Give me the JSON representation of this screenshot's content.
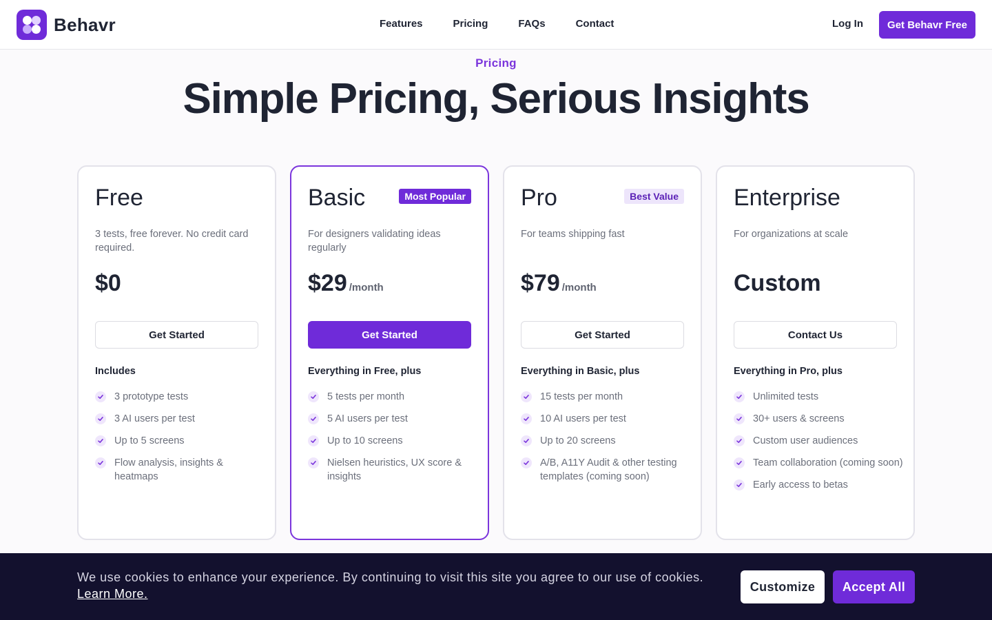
{
  "brand": {
    "name": "Behavr",
    "accent_color": "#6f2bd9",
    "logo_icon": "four-dots-logo-icon"
  },
  "nav": {
    "items": [
      "Features",
      "Pricing",
      "FAQs",
      "Contact"
    ],
    "login_label": "Log In",
    "cta_label": "Get Behavr Free"
  },
  "hero": {
    "eyebrow": "Pricing",
    "title": "Simple Pricing, Serious Insights"
  },
  "plans": [
    {
      "name": "Free",
      "badge": "",
      "description": "3 tests, free forever. No credit card required.",
      "price": "$0",
      "period": "",
      "button_label": "Get Started",
      "includes_label": "Includes",
      "features": [
        "3 prototype tests",
        "3 AI users per test",
        "Up to 5 screens",
        "Flow analysis, insights & heatmaps"
      ]
    },
    {
      "name": "Basic",
      "badge": "Most Popular",
      "description": "For designers validating ideas regularly",
      "price": "$29",
      "period": "/month",
      "button_label": "Get Started",
      "includes_label": "Everything in Free, plus",
      "features": [
        "5 tests per month",
        "5 AI users per test",
        "Up to 10 screens",
        "Nielsen heuristics, UX score & insights"
      ]
    },
    {
      "name": "Pro",
      "badge": "Best Value",
      "description": "For teams shipping fast",
      "price": "$79",
      "period": "/month",
      "button_label": "Get Started",
      "includes_label": "Everything in Basic, plus",
      "features": [
        "15 tests per month",
        "10 AI users per test",
        "Up to 20 screens",
        "A/B, A11Y Audit & other testing templates (coming soon)"
      ]
    },
    {
      "name": "Enterprise",
      "badge": "",
      "description": "For organizations at scale",
      "price": "Custom",
      "period": "",
      "button_label": "Contact Us",
      "includes_label": "Everything in Pro, plus",
      "features": [
        "Unlimited tests",
        "30+ users & screens",
        "Custom user audiences",
        "Team collaboration (coming soon)",
        "Early access to betas"
      ]
    }
  ],
  "cookie_banner": {
    "message": "We use cookies to enhance your experience. By continuing to visit this site you agree to our use of cookies.",
    "link_label": "Learn More.",
    "customize_label": "Customize",
    "accept_label": "Accept All"
  }
}
